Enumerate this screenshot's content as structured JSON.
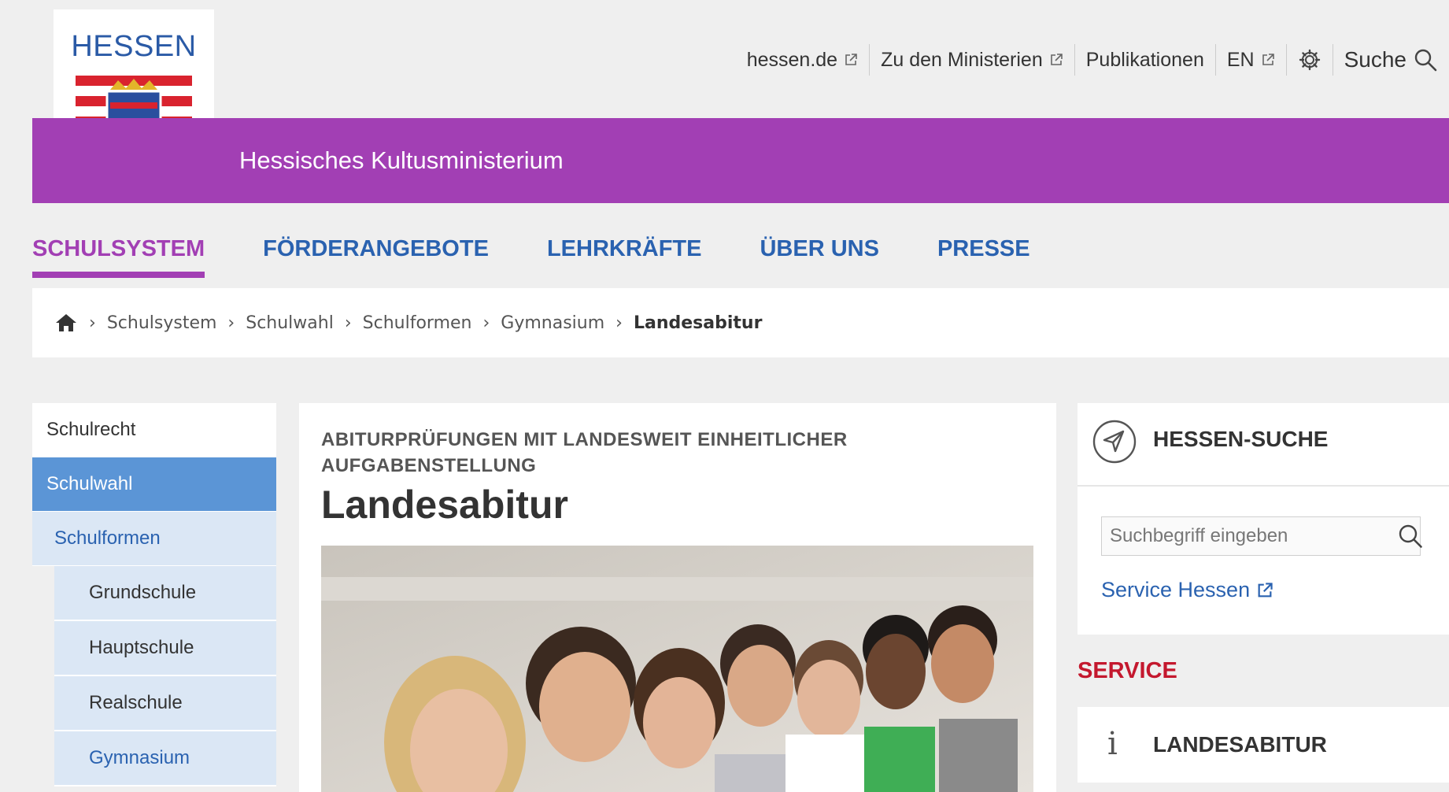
{
  "logo": {
    "text": "HESSEN"
  },
  "utility": {
    "items": [
      {
        "label": "hessen.de",
        "external": true
      },
      {
        "label": "Zu den Ministerien",
        "external": true
      },
      {
        "label": "Publikationen",
        "external": false
      },
      {
        "label": "EN",
        "external": true
      }
    ],
    "search_label": "Suche"
  },
  "ministry": "Hessisches Kultusministerium",
  "nav": [
    {
      "label": "SCHULSYSTEM",
      "active": true
    },
    {
      "label": "FÖRDERANGEBOTE"
    },
    {
      "label": "LEHRKRÄFTE"
    },
    {
      "label": "ÜBER UNS"
    },
    {
      "label": "PRESSE"
    }
  ],
  "breadcrumb": [
    "Schulsystem",
    "Schulwahl",
    "Schulformen",
    "Gymnasium",
    "Landesabitur"
  ],
  "sidebar": {
    "items": [
      {
        "label": "Schulrecht"
      },
      {
        "label": "Schulwahl"
      },
      {
        "label": "Schulformen"
      },
      {
        "label": "Grundschule"
      },
      {
        "label": "Hauptschule"
      },
      {
        "label": "Realschule"
      },
      {
        "label": "Gymnasium"
      }
    ]
  },
  "article": {
    "kicker": "ABITURPRÜFUNGEN MIT LANDESWEIT EINHEITLICHER AUFGABENSTELLUNG",
    "title": "Landesabitur"
  },
  "hessen_search": {
    "title": "HESSEN-SUCHE",
    "placeholder": "Suchbegriff eingeben",
    "link": "Service Hessen"
  },
  "service": {
    "heading": "SERVICE",
    "card_title": "LANDESABITUR"
  },
  "colors": {
    "brand_purple": "#a23fb4",
    "link_blue": "#2a62b0",
    "sidebar_active": "#5b95d6",
    "service_red": "#c4182e"
  }
}
